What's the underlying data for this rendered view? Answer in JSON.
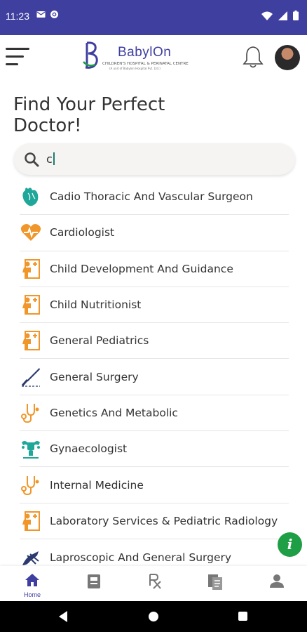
{
  "status_bar": {
    "time": "11:23"
  },
  "header": {
    "brand_name": "BabylOn",
    "brand_sub": "CHILDREN'S HOSPITAL & PERINATAL CENTRE",
    "brand_sub2": "(A unit of Babylon Hospital Pvt. Ltd.)"
  },
  "page": {
    "title_line1": "Find Your Perfect",
    "title_line2": "Doctor!"
  },
  "search": {
    "value": "c"
  },
  "specialties": [
    {
      "label": "Cadio Thoracic And Vascular Surgeon",
      "icon": "heart-organ-icon"
    },
    {
      "label": "Cardiologist",
      "icon": "heartbeat-icon"
    },
    {
      "label": "Child Development And Guidance",
      "icon": "pediatric-icon"
    },
    {
      "label": "Child Nutritionist",
      "icon": "pediatric-icon"
    },
    {
      "label": "General Pediatrics",
      "icon": "pediatric-icon"
    },
    {
      "label": "General Surgery",
      "icon": "scalpel-icon"
    },
    {
      "label": "Genetics And Metabolic",
      "icon": "stethoscope-icon"
    },
    {
      "label": "Gynaecologist",
      "icon": "uterus-icon"
    },
    {
      "label": "Internal Medicine",
      "icon": "stethoscope-icon"
    },
    {
      "label": "Laboratory Services & Pediatric Radiology",
      "icon": "pediatric-icon"
    },
    {
      "label": "Laproscopic And General Surgery",
      "icon": "laparoscopic-icon"
    }
  ],
  "fab": {
    "label": "i"
  },
  "bottom_nav": {
    "home_label": "Home"
  },
  "colors": {
    "primary": "#3f3fa0",
    "accent_orange": "#f0962a",
    "accent_teal": "#1fa89a",
    "fab_green": "#1e9e45"
  }
}
